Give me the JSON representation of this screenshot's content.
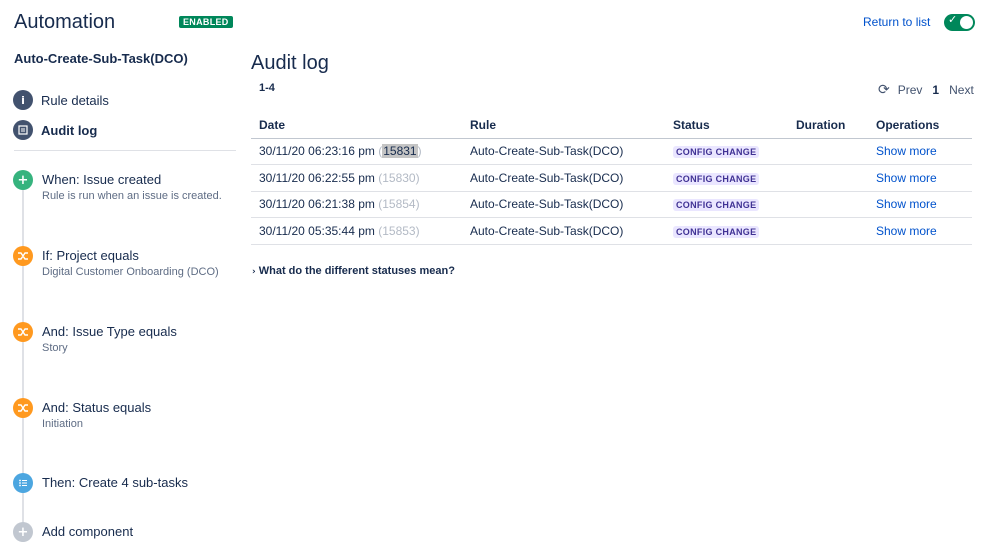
{
  "header": {
    "app_title": "Automation",
    "status_badge": "ENABLED",
    "rule_name": "Auto-Create-Sub-Task(DCO)",
    "return_link": "Return to list",
    "toggle_enabled": true
  },
  "sidebar": {
    "nav": [
      {
        "label": "Rule details",
        "icon": "info-icon"
      },
      {
        "label": "Audit log",
        "icon": "list-icon",
        "active": true
      }
    ],
    "components": [
      {
        "title": "When: Issue created",
        "subtitle": "Rule is run when an issue is created.",
        "icon": "plus-icon",
        "color": "#36b37e"
      },
      {
        "title": "If: Project equals",
        "subtitle": "Digital Customer Onboarding (DCO)",
        "icon": "shuffle-icon",
        "color": "#ff991f"
      },
      {
        "title": "And: Issue Type equals",
        "subtitle": "Story",
        "icon": "shuffle-icon",
        "color": "#ff991f"
      },
      {
        "title": "And: Status equals",
        "subtitle": "Initiation",
        "icon": "shuffle-icon",
        "color": "#ff991f"
      },
      {
        "title": "Then: Create 4 sub-tasks",
        "subtitle": "",
        "icon": "list-icon",
        "color": "#4ca6e0"
      },
      {
        "title": "Add component",
        "subtitle": "",
        "icon": "plus-icon",
        "color": "#c1c7d0"
      }
    ]
  },
  "main": {
    "title": "Audit log",
    "range": "1-4",
    "pager": {
      "prev": "Prev",
      "current": "1",
      "next": "Next"
    },
    "columns": [
      "Date",
      "Rule",
      "Status",
      "Duration",
      "Operations"
    ],
    "rows": [
      {
        "date": "30/11/20 06:23:16 pm",
        "id": "15831",
        "rule": "Auto-Create-Sub-Task(DCO)",
        "status": "CONFIG CHANGE",
        "duration": "",
        "operation": "Show more"
      },
      {
        "date": "30/11/20 06:22:55 pm",
        "id": "15830",
        "rule": "Auto-Create-Sub-Task(DCO)",
        "status": "CONFIG CHANGE",
        "duration": "",
        "operation": "Show more"
      },
      {
        "date": "30/11/20 06:21:38 pm",
        "id": "15854",
        "rule": "Auto-Create-Sub-Task(DCO)",
        "status": "CONFIG CHANGE",
        "duration": "",
        "operation": "Show more"
      },
      {
        "date": "30/11/20 05:35:44 pm",
        "id": "15853",
        "rule": "Auto-Create-Sub-Task(DCO)",
        "status": "CONFIG CHANGE",
        "duration": "",
        "operation": "Show more"
      }
    ],
    "statuses_link": "What do the different statuses mean?"
  }
}
